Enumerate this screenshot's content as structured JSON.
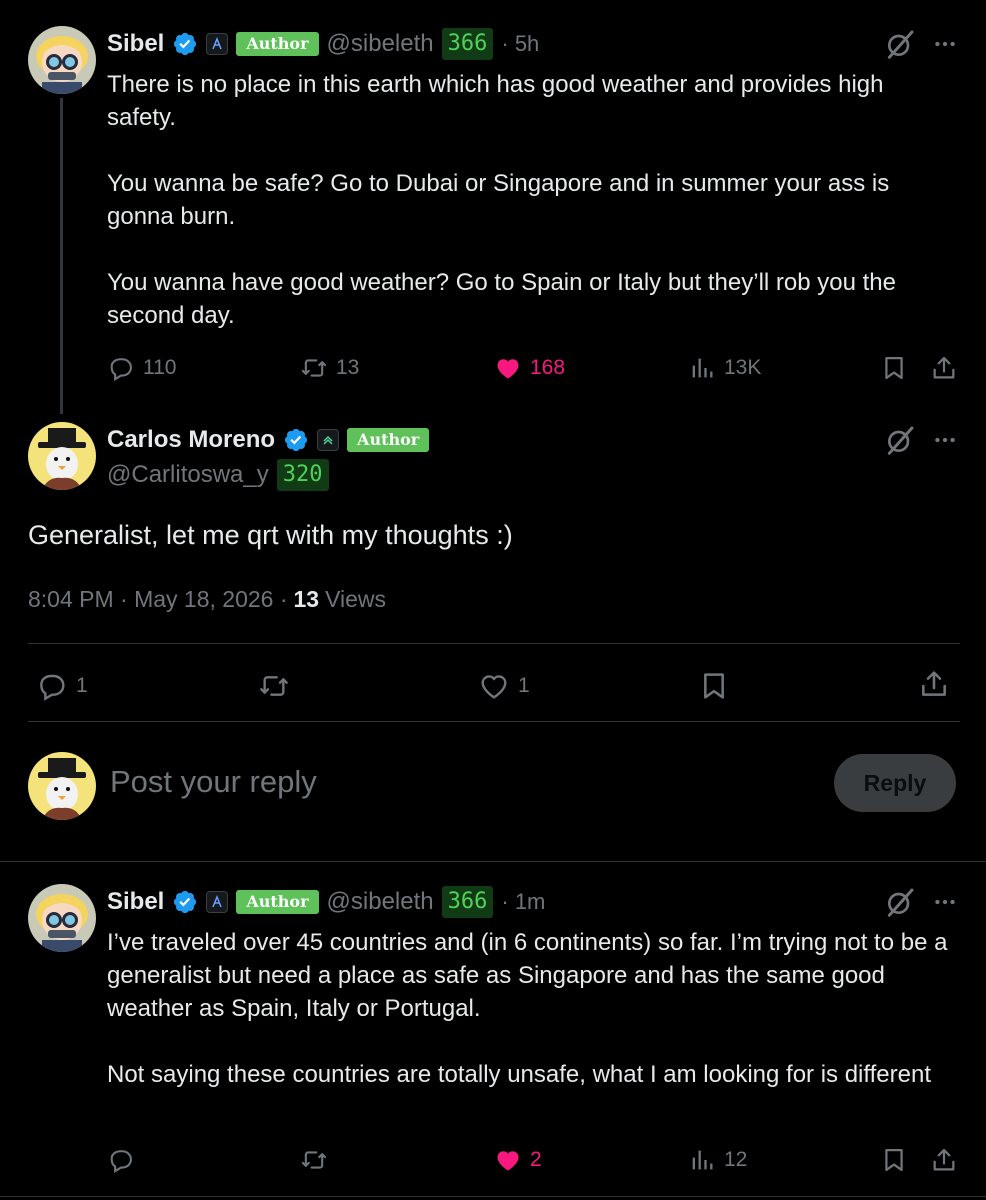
{
  "tweet1": {
    "name": "Sibel",
    "author_badge": "Author",
    "handle": "@sibeleth",
    "score": "366",
    "time": "· 5h",
    "text_p1": "There is no place in this earth which has good weather and provides high safety.",
    "text_p2": "You wanna be safe? Go to Dubai or Singapore and in summer your ass is gonna burn.",
    "text_p3": "You wanna have good weather? Go to Spain or Italy but they’ll rob you the second day.",
    "replies": "110",
    "reposts": "13",
    "likes": "168",
    "views": "13K"
  },
  "main_tweet": {
    "name": "Carlos Moreno",
    "author_badge": "Author",
    "handle": "@Carlitoswa_y",
    "score": "320",
    "text": "Generalist, let me qrt with my thoughts :)",
    "time": "8:04 PM · May 18, 2026 ·",
    "views_count": "13",
    "views_label": "Views",
    "replies": "1",
    "likes": "1"
  },
  "reply_box": {
    "placeholder": "Post your reply",
    "button": "Reply"
  },
  "tweet3": {
    "name": "Sibel",
    "author_badge": "Author",
    "handle": "@sibeleth",
    "score": "366",
    "time": "· 1m",
    "text_p1": "I’ve traveled over 45 countries and (in 6 continents) so far.  I’m trying not to be a generalist but need a place as safe as Singapore and has the same good weather as Spain, Italy or Portugal.",
    "text_p2": "Not saying these countries are totally unsafe, what I am looking for is different",
    "likes": "2",
    "views": "12"
  },
  "colors": {
    "background": "#000000",
    "text": "#e7e9ea",
    "muted": "#71767b",
    "like": "#f91880",
    "verified": "#1d9bf0",
    "author_badge": "#5fc15a",
    "score_bg": "#113b14",
    "score_text": "#4fd15a"
  }
}
